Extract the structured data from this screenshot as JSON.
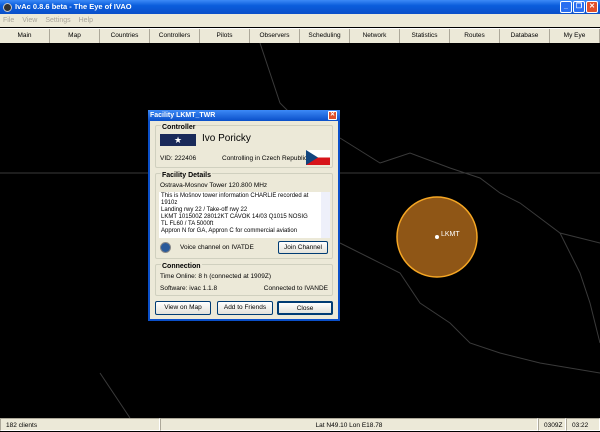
{
  "window": {
    "title": "IvAc 0.8.6 beta - The Eye of IVAO"
  },
  "menu": [
    "File",
    "View",
    "Settings",
    "Help"
  ],
  "tabs": [
    "Main",
    "Map",
    "Countries",
    "Controllers",
    "Pilots",
    "Observers",
    "Scheduling",
    "Network",
    "Statistics",
    "Routes",
    "Database",
    "My Eye"
  ],
  "map": {
    "station_label": "LKMT",
    "circle_color": "#f5a623"
  },
  "dialog": {
    "title": "Facility LKMT_TWR",
    "controller": {
      "heading": "Controller",
      "name": "Ivo Poricky",
      "vid": "VID: 222406",
      "controlling": "Controlling in Czech Republic"
    },
    "facility": {
      "heading": "Facility Details",
      "name": "Ostrava-Mosnov Tower 120.800 MHz",
      "atis": [
        "This is Mošnov tower information CHARLIE recorded at 1910z",
        "Landing rwy 22 / Take-off rwy 22",
        "LKMT 101500Z 28012KT CAVOK 14/03 Q1015 NOSIG",
        "TL FL60 / TA 5000ft",
        "Appron N for GA, Appron C for commercial aviation"
      ],
      "voice": "Voice channel on IVATDE",
      "join": "Join Channel"
    },
    "connection": {
      "heading": "Connection",
      "time_online": "Time Online: 8 h  (connected at 1909Z)",
      "software": "Software: ivac 1.1.8",
      "server": "Connected to IVANDE"
    },
    "buttons": {
      "view_map": "View on Map",
      "add_friends": "Add to Friends",
      "close": "Close"
    }
  },
  "status": {
    "clients": "182 clients",
    "position": "Lat N49.10 Lon E18.78",
    "utc": "0309Z",
    "local": "03:22"
  }
}
